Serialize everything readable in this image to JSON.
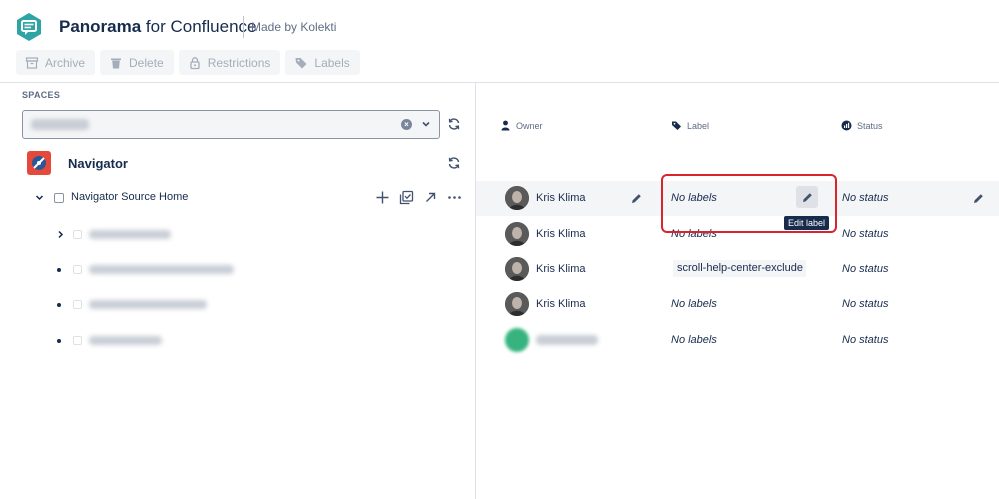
{
  "header": {
    "app_name_bold": "Panorama",
    "app_name_rest": " for Confluence",
    "made_by": "Made by Kolekti",
    "brand_color": "#2fa4a5"
  },
  "toolbar": {
    "archive": "Archive",
    "delete": "Delete",
    "restrictions": "Restrictions",
    "labels": "Labels"
  },
  "spaces": {
    "section_label": "SPACES",
    "space_name": "Navigator",
    "space_color": "#e5493a"
  },
  "tree": {
    "root_title": "Navigator Source Home"
  },
  "grid": {
    "columns": {
      "owner": "Owner",
      "label": "Label",
      "status": "Status"
    },
    "rows": [
      {
        "owner": "Kris Klima",
        "label": "No labels",
        "status": "No status"
      },
      {
        "owner": "Kris Klima",
        "label": "No labels",
        "status": "No status"
      },
      {
        "owner": "Kris Klima",
        "label": "scroll-help-center-exclude",
        "status": "No status"
      },
      {
        "owner": "Kris Klima",
        "label": "No labels",
        "status": "No status"
      },
      {
        "owner": "",
        "label": "No labels",
        "status": "No status"
      }
    ],
    "tooltip": "Edit label",
    "highlight_color": "#d9232e"
  }
}
